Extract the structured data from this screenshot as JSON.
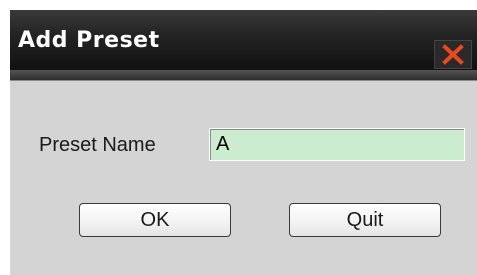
{
  "dialog": {
    "title": "Add Preset",
    "close_icon": "close-icon",
    "close_color": "#e8491e",
    "background": "#d4d4d4"
  },
  "form": {
    "preset_name_label": "Preset Name",
    "preset_name_value": "A",
    "input_background": "#ccecd0"
  },
  "buttons": {
    "ok_label": "OK",
    "quit_label": "Quit"
  }
}
